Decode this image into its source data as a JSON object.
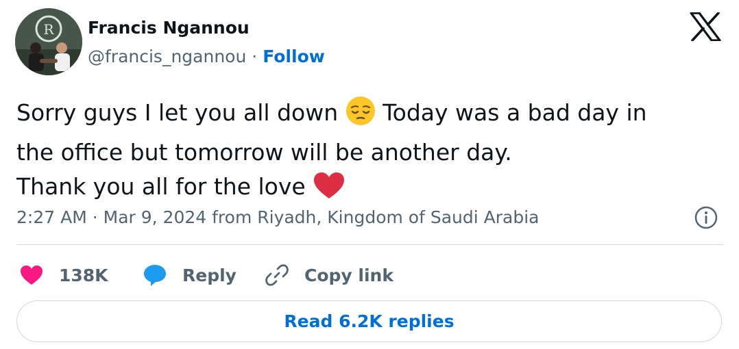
{
  "author": {
    "name": "Francis Ngannou",
    "handle": "@francis_ngannou",
    "separator": "·",
    "follow_label": "Follow"
  },
  "tweet": {
    "line1_before_emoji": "Sorry guys I let you all down ",
    "line1_after_emoji": " Today was a bad day in",
    "line2": "the office but tomorrow will be another day.",
    "line3_before_emoji": "Thank you all for the love ",
    "emoji_1": "pensive-face",
    "emoji_2": "red-heart"
  },
  "meta": {
    "time": "2:27 AM",
    "separator": "·",
    "date": "Mar 9, 2024",
    "location": "from Riyadh, Kingdom of Saudi Arabia"
  },
  "actions": {
    "like_count": "138K",
    "reply_label": "Reply",
    "copy_label": "Copy link"
  },
  "read_replies_label": "Read 6.2K replies",
  "colors": {
    "accent": "#006fd6",
    "like": "#f91880",
    "reply": "#1d9bf0",
    "secondary_text": "#536471",
    "primary_text": "#0f1419",
    "border": "#cfd9de"
  },
  "icons": [
    "x-logo-icon",
    "info-icon",
    "heart-icon",
    "reply-bubble-icon",
    "link-icon"
  ]
}
